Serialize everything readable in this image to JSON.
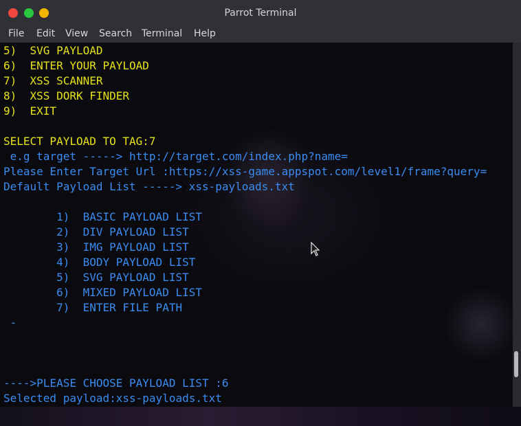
{
  "window": {
    "title": "Parrot Terminal"
  },
  "menu": {
    "file": "File",
    "edit": "Edit",
    "view": "View",
    "search": "Search",
    "terminal": "Terminal",
    "help": "Help"
  },
  "terminal": {
    "lines": [
      "5)  SVG PAYLOAD",
      "6)  ENTER YOUR PAYLOAD",
      "7)  XSS SCANNER",
      "8)  XSS DORK FINDER",
      "9)  EXIT",
      "",
      "SELECT PAYLOAD TO TAG:7",
      " e.g target -----> http://target.com/index.php?name=",
      "Please Enter Target Url :https://xss-game.appspot.com/level1/frame?query=",
      "Default Payload List -----> xss-payloads.txt",
      "",
      "        1)  BASIC PAYLOAD LIST",
      "        2)  DIV PAYLOAD LIST",
      "        3)  IMG PAYLOAD LIST",
      "        4)  BODY PAYLOAD LIST",
      "        5)  SVG PAYLOAD LIST",
      "        6)  MIXED PAYLOAD LIST",
      "        7)  ENTER FILE PATH",
      " -",
      "",
      "",
      "",
      "---->PLEASE CHOOSE PAYLOAD LIST :6",
      "Selected payload:xss-payloads.txt"
    ],
    "colors": {
      "yellow": "#e6e21a",
      "blue": "#3b8cf0"
    }
  }
}
